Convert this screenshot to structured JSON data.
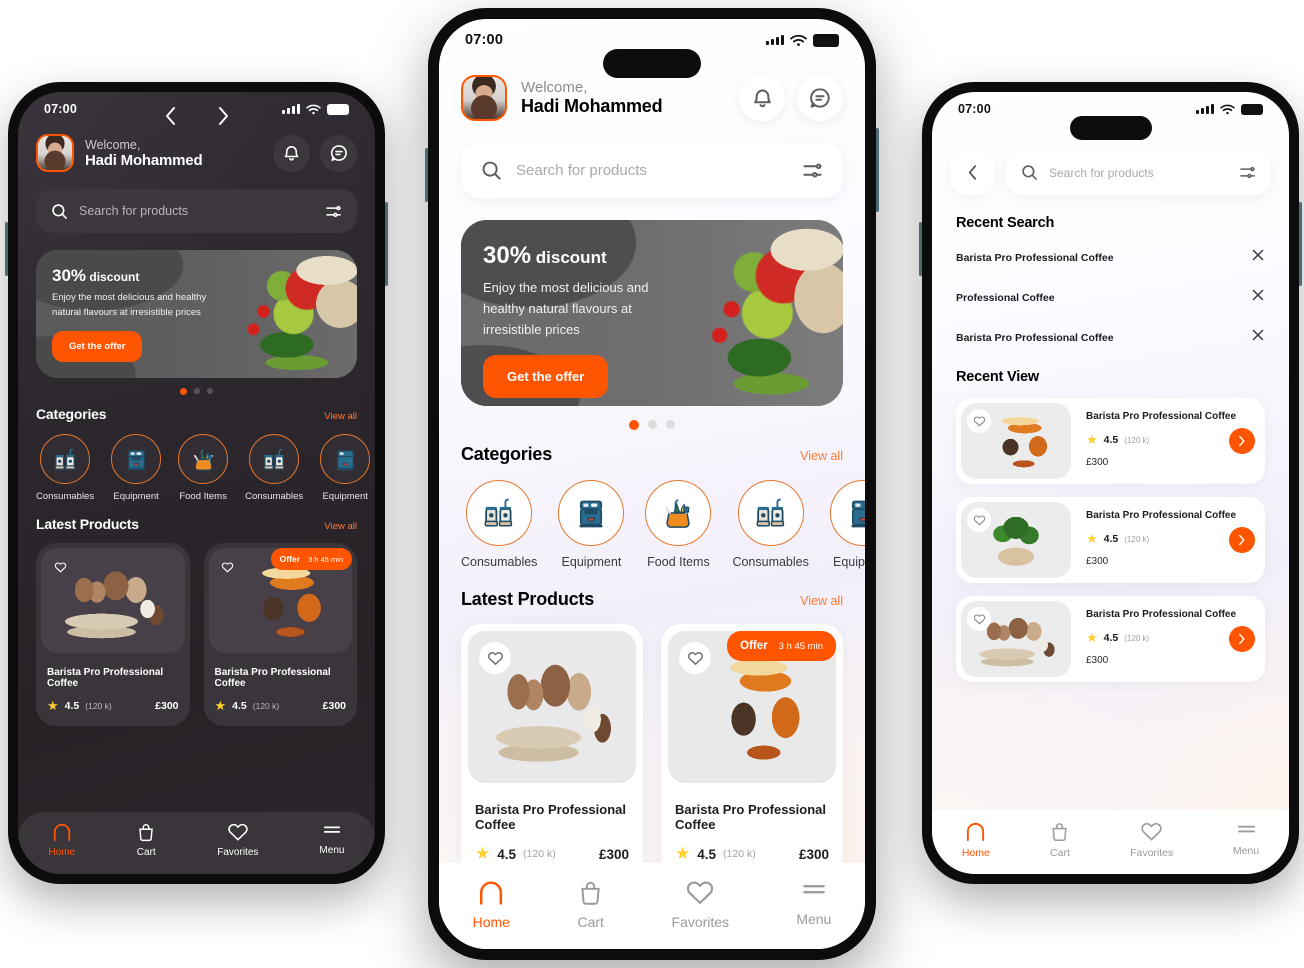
{
  "accent": "#FF5500",
  "status_bar": {
    "time": "07:00",
    "signal_icon": "cellular-bars-icon",
    "wifi_icon": "wifi-icon",
    "battery_icon": "battery-icon"
  },
  "header": {
    "welcome_label": "Welcome,",
    "user_name": "Hadi Mohammed",
    "avatar_name": "user-avatar",
    "notification_icon": "bell-icon",
    "chat_icon": "chat-bubble-icon",
    "prev_icon": "chevron-left-icon",
    "next_icon": "chevron-right-icon"
  },
  "search": {
    "placeholder": "Search for products",
    "search_icon": "search-icon",
    "filter_icon": "sliders-filter-icon",
    "back_icon": "chevron-left-icon"
  },
  "banner": {
    "percent": "30%",
    "discount_word": "discount",
    "subtitle": "Enjoy the most delicious and healthy natural flavours at irresistible prices",
    "cta": "Get the offer",
    "dots_total": 3,
    "dot_active_index": 0
  },
  "categories_section": {
    "title": "Categories",
    "view_all": "View all",
    "items": [
      {
        "label": "Consumables",
        "icon": "coffee-cups-icon"
      },
      {
        "label": "Equipment",
        "icon": "espresso-machine-icon"
      },
      {
        "label": "Food Items",
        "icon": "grocery-bag-icon"
      },
      {
        "label": "Consumables",
        "icon": "coffee-cups-icon"
      },
      {
        "label": "Equipment",
        "icon": "espresso-machine-icon"
      }
    ]
  },
  "products_section": {
    "title": "Latest Products",
    "view_all": "View all",
    "offer_label": "Offer",
    "offer_time": "3 h 45 min",
    "items": [
      {
        "name": "Barista Pro Professional Coffee",
        "rating": "4.5",
        "reviews": "(120 k)",
        "price": "£300",
        "art": "art-crate",
        "has_offer": false
      },
      {
        "name": "Barista Pro Professional Coffee",
        "rating": "4.5",
        "reviews": "(120 k)",
        "price": "£300",
        "art": "art-mixer",
        "has_offer": true
      }
    ]
  },
  "search_screen": {
    "recent_search_title": "Recent Search",
    "recent_searches": [
      {
        "text": "Barista Pro Professional Coffee",
        "remove_icon": "close-x-icon"
      },
      {
        "text": "Professional Coffee",
        "remove_icon": "close-x-icon"
      },
      {
        "text": "Barista Pro Professional Coffee",
        "remove_icon": "close-x-icon"
      }
    ],
    "recent_view_title": "Recent View",
    "recent_views": [
      {
        "name": "Barista Pro Professional Coffee",
        "rating": "4.5",
        "reviews": "(120 k)",
        "price": "£300",
        "art": "art-mixer"
      },
      {
        "name": "Barista Pro Professional Coffee",
        "rating": "4.5",
        "reviews": "(120 k)",
        "price": "£300",
        "art": "art-herb"
      },
      {
        "name": "Barista Pro Professional Coffee",
        "rating": "4.5",
        "reviews": "(120 k)",
        "price": "£300",
        "art": "art-crate"
      }
    ],
    "go_icon": "chevron-right-icon"
  },
  "bottom_nav": {
    "items": [
      {
        "label": "Home",
        "icon": "home-icon",
        "active": true
      },
      {
        "label": "Cart",
        "icon": "bag-icon",
        "active": false
      },
      {
        "label": "Favorites",
        "icon": "heart-icon",
        "active": false
      },
      {
        "label": "Menu",
        "icon": "hamburger-icon",
        "active": false
      }
    ]
  }
}
